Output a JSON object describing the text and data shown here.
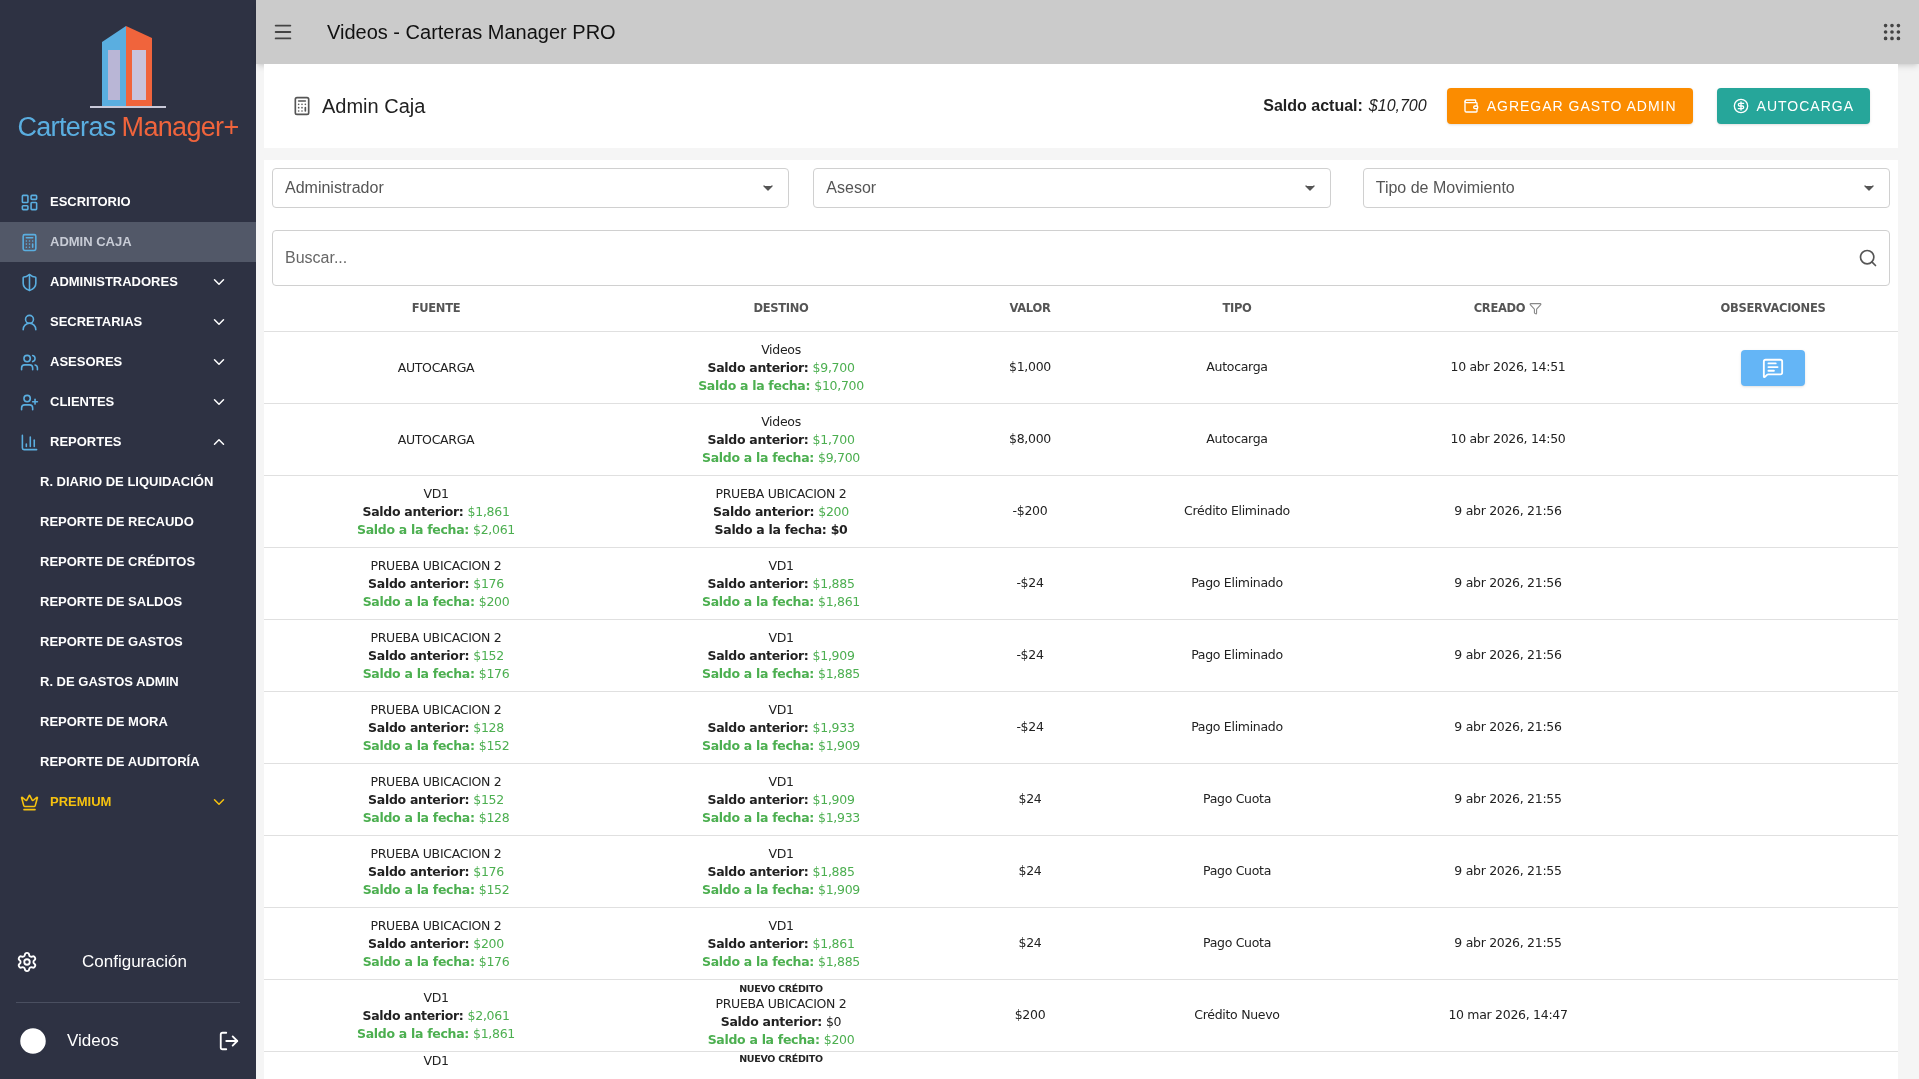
{
  "logo": {
    "word1": "Carteras",
    "word2": "Manager+"
  },
  "sidebar": {
    "items": [
      {
        "label": "ESCRITORIO",
        "kind": "item",
        "selected": false
      },
      {
        "label": "ADMIN CAJA",
        "kind": "item",
        "selected": true
      },
      {
        "label": "ADMINISTRADORES",
        "kind": "item",
        "selected": false,
        "expanded": false
      },
      {
        "label": "SECRETARIAS",
        "kind": "item",
        "selected": false,
        "expanded": false
      },
      {
        "label": "ASESORES",
        "kind": "item",
        "selected": false,
        "expanded": false
      },
      {
        "label": "CLIENTES",
        "kind": "item",
        "selected": false,
        "expanded": false
      },
      {
        "label": "REPORTES",
        "kind": "item",
        "selected": false,
        "expanded": true,
        "children": [
          {
            "label": "R. DIARIO DE LIQUIDACIÓN",
            "selected": false
          },
          {
            "label": "REPORTE DE RECAUDO",
            "selected": false
          },
          {
            "label": "REPORTE DE CRÉDITOS",
            "selected": false
          },
          {
            "label": "REPORTE DE SALDOS",
            "selected": false
          },
          {
            "label": "REPORTE DE GASTOS",
            "selected": false
          },
          {
            "label": "R. DE GASTOS ADMIN",
            "selected": false
          },
          {
            "label": "REPORTE DE MORA",
            "selected": false
          },
          {
            "label": "REPORTE DE AUDITORÍA",
            "selected": false
          }
        ]
      },
      {
        "label": "PREMIUM",
        "kind": "premium",
        "selected": false,
        "expanded": false
      }
    ],
    "settings": "Configuración",
    "user": "Videos"
  },
  "topbar": {
    "title": "Videos - Carteras Manager PRO"
  },
  "page": {
    "title": "Admin Caja",
    "balance_label": "Saldo actual:",
    "balance_value": "$10,700",
    "buttons": [
      {
        "label": "AGREGAR GASTO ADMIN",
        "kind": "expense"
      },
      {
        "label": "AUTOCARGA",
        "kind": "load"
      }
    ]
  },
  "filters": [
    {
      "placeholder": "Administrador"
    },
    {
      "placeholder": "Asesor"
    },
    {
      "placeholder": "Tipo de Movimiento"
    }
  ],
  "search": {
    "placeholder": "Buscar..."
  },
  "table": {
    "columns": [
      "FUENTE",
      "DESTINO",
      "VALOR",
      "TIPO",
      "CREADO",
      "OBSERVACIONES"
    ],
    "rows": [
      {
        "fuente": {
          "name": "AUTOCARGA"
        },
        "destino": {
          "name": "Videos",
          "anterior": {
            "label": "Saldo anterior:",
            "value": "$9,700",
            "green": true
          },
          "fecha": {
            "label": "Saldo a la fecha:",
            "value": "$10,700",
            "green": true
          }
        },
        "valor": "$1,000",
        "tipo": "Autocarga",
        "creado": "10 abr 2026, 14:51",
        "observation": true
      },
      {
        "fuente": {
          "name": "AUTOCARGA"
        },
        "destino": {
          "name": "Videos",
          "anterior": {
            "label": "Saldo anterior:",
            "value": "$1,700",
            "green": true
          },
          "fecha": {
            "label": "Saldo a la fecha:",
            "value": "$9,700",
            "green": true
          }
        },
        "valor": "$8,000",
        "tipo": "Autocarga",
        "creado": "10 abr 2026, 14:50",
        "observation": false
      },
      {
        "fuente": {
          "name": "VD1",
          "anterior": {
            "label": "Saldo anterior:",
            "value": "$1,861",
            "green": true
          },
          "fecha": {
            "label": "Saldo a la fecha:",
            "value": "$2,061",
            "green": true
          }
        },
        "destino": {
          "name": "PRUEBA UBICACION 2",
          "anterior": {
            "label": "Saldo anterior:",
            "value": "$200",
            "green": true
          },
          "fecha": {
            "label": "Saldo a la fecha:",
            "value": "$0",
            "green": false
          }
        },
        "valor": "-$200",
        "tipo": "Crédito Eliminado",
        "creado": "9 abr 2026, 21:56",
        "observation": false
      },
      {
        "fuente": {
          "name": "PRUEBA UBICACION 2",
          "anterior": {
            "label": "Saldo anterior:",
            "value": "$176",
            "green": true
          },
          "fecha": {
            "label": "Saldo a la fecha:",
            "value": "$200",
            "green": true
          }
        },
        "destino": {
          "name": "VD1",
          "anterior": {
            "label": "Saldo anterior:",
            "value": "$1,885",
            "green": true
          },
          "fecha": {
            "label": "Saldo a la fecha:",
            "value": "$1,861",
            "green": true
          }
        },
        "valor": "-$24",
        "tipo": "Pago Eliminado",
        "creado": "9 abr 2026, 21:56",
        "observation": false
      },
      {
        "fuente": {
          "name": "PRUEBA UBICACION 2",
          "anterior": {
            "label": "Saldo anterior:",
            "value": "$152",
            "green": true
          },
          "fecha": {
            "label": "Saldo a la fecha:",
            "value": "$176",
            "green": true
          }
        },
        "destino": {
          "name": "VD1",
          "anterior": {
            "label": "Saldo anterior:",
            "value": "$1,909",
            "green": true
          },
          "fecha": {
            "label": "Saldo a la fecha:",
            "value": "$1,885",
            "green": true
          }
        },
        "valor": "-$24",
        "tipo": "Pago Eliminado",
        "creado": "9 abr 2026, 21:56",
        "observation": false
      },
      {
        "fuente": {
          "name": "PRUEBA UBICACION 2",
          "anterior": {
            "label": "Saldo anterior:",
            "value": "$128",
            "green": true
          },
          "fecha": {
            "label": "Saldo a la fecha:",
            "value": "$152",
            "green": true
          }
        },
        "destino": {
          "name": "VD1",
          "anterior": {
            "label": "Saldo anterior:",
            "value": "$1,933",
            "green": true
          },
          "fecha": {
            "label": "Saldo a la fecha:",
            "value": "$1,909",
            "green": true
          }
        },
        "valor": "-$24",
        "tipo": "Pago Eliminado",
        "creado": "9 abr 2026, 21:56",
        "observation": false
      },
      {
        "fuente": {
          "name": "PRUEBA UBICACION 2",
          "anterior": {
            "label": "Saldo anterior:",
            "value": "$152",
            "green": true
          },
          "fecha": {
            "label": "Saldo a la fecha:",
            "value": "$128",
            "green": true
          }
        },
        "destino": {
          "name": "VD1",
          "anterior": {
            "label": "Saldo anterior:",
            "value": "$1,909",
            "green": true
          },
          "fecha": {
            "label": "Saldo a la fecha:",
            "value": "$1,933",
            "green": true
          }
        },
        "valor": "$24",
        "tipo": "Pago Cuota",
        "creado": "9 abr 2026, 21:55",
        "observation": false
      },
      {
        "fuente": {
          "name": "PRUEBA UBICACION 2",
          "anterior": {
            "label": "Saldo anterior:",
            "value": "$176",
            "green": true
          },
          "fecha": {
            "label": "Saldo a la fecha:",
            "value": "$152",
            "green": true
          }
        },
        "destino": {
          "name": "VD1",
          "anterior": {
            "label": "Saldo anterior:",
            "value": "$1,885",
            "green": true
          },
          "fecha": {
            "label": "Saldo a la fecha:",
            "value": "$1,909",
            "green": true
          }
        },
        "valor": "$24",
        "tipo": "Pago Cuota",
        "creado": "9 abr 2026, 21:55",
        "observation": false
      },
      {
        "fuente": {
          "name": "PRUEBA UBICACION 2",
          "anterior": {
            "label": "Saldo anterior:",
            "value": "$200",
            "green": true
          },
          "fecha": {
            "label": "Saldo a la fecha:",
            "value": "$176",
            "green": true
          }
        },
        "destino": {
          "name": "VD1",
          "anterior": {
            "label": "Saldo anterior:",
            "value": "$1,861",
            "green": true
          },
          "fecha": {
            "label": "Saldo a la fecha:",
            "value": "$1,885",
            "green": true
          }
        },
        "valor": "$24",
        "tipo": "Pago Cuota",
        "creado": "9 abr 2026, 21:55",
        "observation": false
      },
      {
        "fuente": {
          "name": "VD1",
          "anterior": {
            "label": "Saldo anterior:",
            "value": "$2,061",
            "green": true
          },
          "fecha": {
            "label": "Saldo a la fecha:",
            "value": "$1,861",
            "green": true
          }
        },
        "destino": {
          "tag": "NUEVO CRÉDITO",
          "name": "PRUEBA UBICACION 2",
          "anterior": {
            "label": "Saldo anterior:",
            "value": "$0",
            "green": false
          },
          "fecha": {
            "label": "Saldo a la fecha:",
            "value": "$200",
            "green": true
          }
        },
        "valor": "$200",
        "tipo": "Crédito Nuevo",
        "creado": "10 mar 2026, 14:47",
        "observation": false
      },
      {
        "fuente": {
          "name": "VD1"
        },
        "destino": {
          "tag": "NUEVO CRÉDITO"
        },
        "partial": true
      }
    ]
  }
}
